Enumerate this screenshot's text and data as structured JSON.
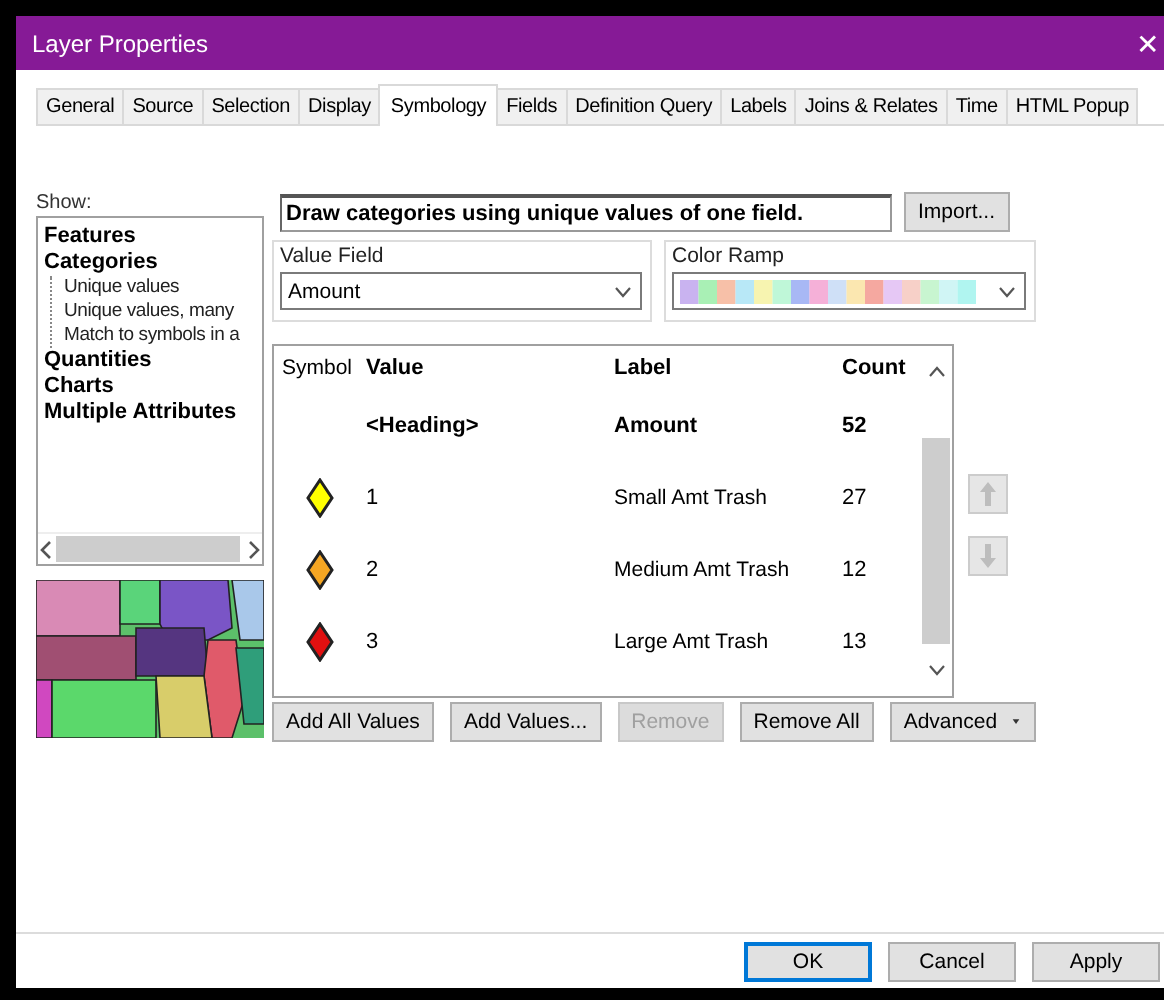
{
  "window": {
    "title": "Layer Properties",
    "close": "✕"
  },
  "tabs": [
    {
      "label": "General",
      "selected": false
    },
    {
      "label": "Source",
      "selected": false
    },
    {
      "label": "Selection",
      "selected": false
    },
    {
      "label": "Display",
      "selected": false
    },
    {
      "label": "Symbology",
      "selected": true
    },
    {
      "label": "Fields",
      "selected": false
    },
    {
      "label": "Definition Query",
      "selected": false
    },
    {
      "label": "Labels",
      "selected": false
    },
    {
      "label": "Joins & Relates",
      "selected": false
    },
    {
      "label": "Time",
      "selected": false
    },
    {
      "label": "HTML Popup",
      "selected": false
    }
  ],
  "show": {
    "label": "Show:",
    "items": [
      {
        "label": "Features"
      },
      {
        "label": "Categories",
        "children": [
          {
            "label": "Unique values"
          },
          {
            "label": "Unique values, many"
          },
          {
            "label": "Match to symbols in a"
          }
        ]
      },
      {
        "label": "Quantities"
      },
      {
        "label": "Charts"
      },
      {
        "label": "Multiple Attributes"
      }
    ]
  },
  "description": "Draw categories using unique values of one field.",
  "import_button": "Import...",
  "value_field": {
    "label": "Value Field",
    "value": "Amount"
  },
  "color_ramp": {
    "label": "Color Ramp"
  },
  "table": {
    "columns": [
      "Symbol",
      "Value",
      "Label",
      "Count"
    ],
    "heading": {
      "value": "<Heading>",
      "label": "Amount",
      "count": "52"
    },
    "rows": [
      {
        "color": "#ffff00",
        "value": "1",
        "label": "Small Amt Trash",
        "count": "27"
      },
      {
        "color": "#f5a623",
        "value": "2",
        "label": "Medium Amt Trash",
        "count": "12"
      },
      {
        "color": "#e01010",
        "value": "3",
        "label": "Large Amt Trash",
        "count": "13"
      }
    ]
  },
  "buttons": [
    {
      "label": "Add All Values",
      "disabled": false
    },
    {
      "label": "Add Values...",
      "disabled": false
    },
    {
      "label": "Remove",
      "disabled": true
    },
    {
      "label": "Remove All",
      "disabled": false
    },
    {
      "label": "Advanced",
      "disabled": false,
      "menu": true
    }
  ],
  "dialog_buttons": [
    {
      "label": "OK",
      "default": true
    },
    {
      "label": "Cancel",
      "default": false
    },
    {
      "label": "Apply",
      "default": false
    }
  ]
}
